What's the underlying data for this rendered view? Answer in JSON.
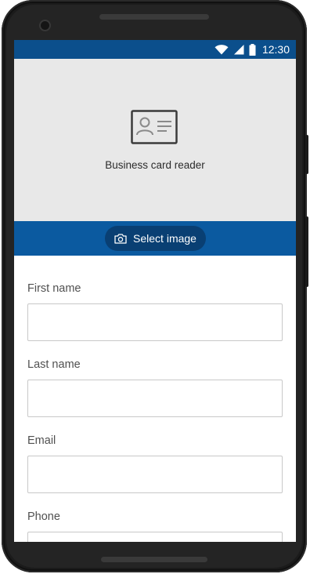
{
  "status_bar": {
    "time": "12:30",
    "icons": [
      "wifi-icon",
      "cellular-signal-icon",
      "battery-icon"
    ]
  },
  "hero": {
    "icon": "contact-card-icon",
    "title": "Business card reader"
  },
  "action": {
    "icon": "camera-icon",
    "select_image_label": "Select image"
  },
  "form": {
    "fields": [
      {
        "label": "First name",
        "value": "",
        "placeholder": ""
      },
      {
        "label": "Last name",
        "value": "",
        "placeholder": ""
      },
      {
        "label": "Email",
        "value": "",
        "placeholder": ""
      },
      {
        "label": "Phone",
        "value": "",
        "placeholder": ""
      }
    ]
  },
  "colors": {
    "status_bar": "#0b4f8c",
    "action_band": "#0b5aa0",
    "button": "#093f73",
    "hero_bg": "#e8e8e8"
  }
}
